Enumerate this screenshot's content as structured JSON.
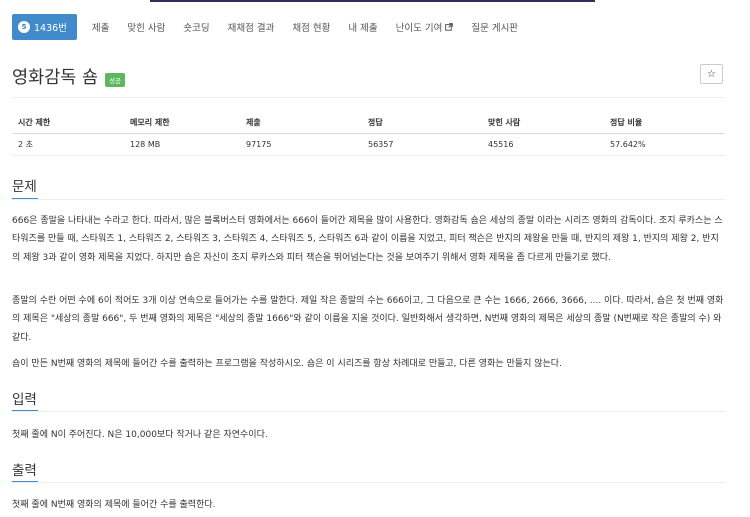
{
  "tabs": {
    "problem_number": "1436번",
    "submit": "제출",
    "solved_users": "맞힌 사람",
    "shortest": "숏코딩",
    "rejudge_results": "재채점 결과",
    "judge_status": "채점 현황",
    "my_submissions": "내 제출",
    "difficulty_contribution": "난이도 기여",
    "board": "질문 게시판"
  },
  "problem": {
    "title": "영화감독 숌",
    "status": "성공",
    "star": "☆"
  },
  "info_table": {
    "headers": [
      "시간 제한",
      "메모리 제한",
      "제출",
      "정답",
      "맞힌 사람",
      "정답 비율"
    ],
    "values": [
      "2 초",
      "128 MB",
      "97175",
      "56357",
      "45516",
      "57.642%"
    ]
  },
  "sections": {
    "description": {
      "heading": "문제",
      "paragraphs": [
        "666은 종말을 나타내는 수라고 한다. 따라서, 많은 블록버스터 영화에서는 666이 들어간 제목을 많이 사용한다. 영화감독 숌은 세상의 종말 이라는 시리즈 영화의 감독이다. 조지 루카스는 스타워즈를 만들 때, 스타워즈 1, 스타워즈 2, 스타워즈 3, 스타워즈 4, 스타워즈 5, 스타워즈 6과 같이 이름을 지었고, 피터 잭슨은 반지의 제왕을 만들 때, 반지의 제왕 1, 반지의 제왕 2, 반지의 제왕 3과 같이 영화 제목을 지었다. 하지만 숌은 자신이 조지 루카스와 피터 잭슨을 뛰어넘는다는 것을 보여주기 위해서 영화 제목을 좀 다르게 만들기로 했다.",
        "종말의 수란 어떤 수에 6이 적어도 3개 이상 연속으로 들어가는 수를 말한다. 제일 작은 종말의 수는 666이고, 그 다음으로 큰 수는 1666, 2666, 3666, .... 이다. 따라서, 숌은 첫 번째 영화의 제목은 \"세상의 종말 666\", 두 번째 영화의 제목은 \"세상의 종말 1666\"와 같이 이름을 지을 것이다. 일반화해서 생각하면, N번째 영화의 제목은 세상의 종말 (N번째로 작은 종말의 수) 와 같다.",
        "숌이 만든 N번째 영화의 제목에 들어간 수를 출력하는 프로그램을 작성하시오. 숌은 이 시리즈를 항상 차례대로 만들고, 다른 영화는 만들지 않는다."
      ]
    },
    "input": {
      "heading": "입력",
      "text": "첫째 줄에 N이 주어진다. N은 10,000보다 작거나 같은 자연수이다."
    },
    "output": {
      "heading": "출력",
      "text": "첫째 줄에 N번째 영화의 제목에 들어간 수를 출력한다."
    }
  }
}
